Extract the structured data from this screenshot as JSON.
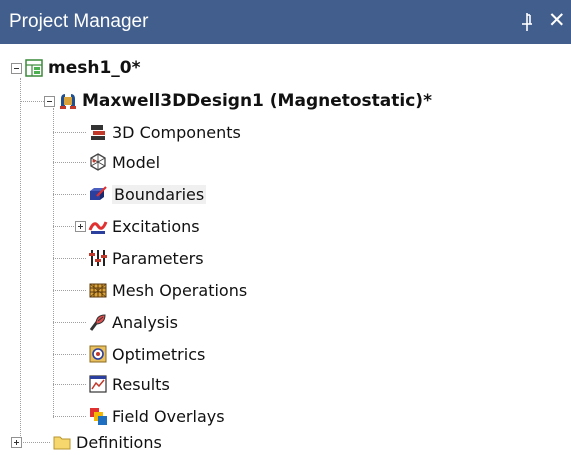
{
  "panel": {
    "title": "Project Manager",
    "pin_icon": "pin-icon",
    "close_icon": "close-icon",
    "close_glyph": "✕"
  },
  "tree": {
    "project": {
      "label": "mesh1_0*",
      "icon": "project-icon",
      "expanded": true
    },
    "design": {
      "label": "Maxwell3DDesign1 (Magnetostatic)*",
      "icon": "maxwell-design-icon",
      "expanded": true
    },
    "children": [
      {
        "label": "3D Components",
        "icon": "3d-components-icon"
      },
      {
        "label": "Model",
        "icon": "model-icon"
      },
      {
        "label": "Boundaries",
        "icon": "boundaries-icon",
        "highlighted": true
      },
      {
        "label": "Excitations",
        "icon": "excitations-icon",
        "expandable": true
      },
      {
        "label": "Parameters",
        "icon": "parameters-icon"
      },
      {
        "label": "Mesh Operations",
        "icon": "mesh-operations-icon"
      },
      {
        "label": "Analysis",
        "icon": "analysis-icon"
      },
      {
        "label": "Optimetrics",
        "icon": "optimetrics-icon"
      },
      {
        "label": "Results",
        "icon": "results-icon"
      },
      {
        "label": "Field Overlays",
        "icon": "field-overlays-icon"
      }
    ],
    "definitions": {
      "label": "Definitions",
      "icon": "folder-icon",
      "expandable": true
    }
  },
  "colors": {
    "titlebar": "#415e8c",
    "title_text": "#ffffff",
    "tree_lines": "#a0a0a0"
  }
}
